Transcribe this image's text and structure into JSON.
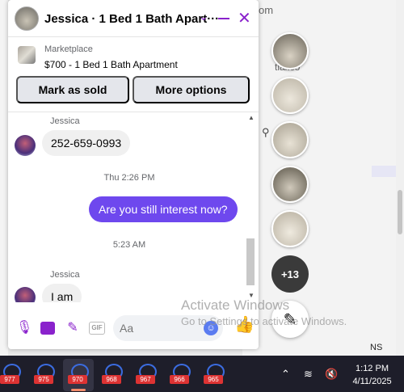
{
  "background": {
    "partial_text_top": "om",
    "partial_text_mid": "tial.co",
    "taskbar_fragment": "NS"
  },
  "chat": {
    "title": "Jessica · 1 Bed 1 Bath Apart···",
    "listing": {
      "label": "Marketplace",
      "price_title": "$700 - 1 Bed 1 Bath Apartment"
    },
    "buttons": {
      "mark_sold": "Mark as sold",
      "more_options": "More options"
    },
    "messages": [
      {
        "sender": "Jessica",
        "text": "252-659-0993"
      },
      {
        "timestamp": "Thu 2:26 PM"
      },
      {
        "text": "Are you still interest now?"
      },
      {
        "timestamp": "5:23 AM"
      },
      {
        "sender": "Jessica",
        "text": "I am"
      }
    ],
    "composer": {
      "placeholder": "Aa",
      "gif_label": "GIF"
    }
  },
  "side_chats": {
    "more_count": "+13"
  },
  "watermark": {
    "line1": "Activate Windows",
    "line2": "Go to Settings to activate Windows."
  },
  "taskbar": {
    "badges": [
      "977",
      "975",
      "970",
      "968",
      "967",
      "966",
      "965"
    ],
    "clock_time": "1:12 PM",
    "clock_date": "4/11/2025"
  },
  "colors": {
    "accent": "#8a22cc",
    "outgoing_bubble": "#6e48ee",
    "incoming_bubble": "#f0f0f0"
  }
}
